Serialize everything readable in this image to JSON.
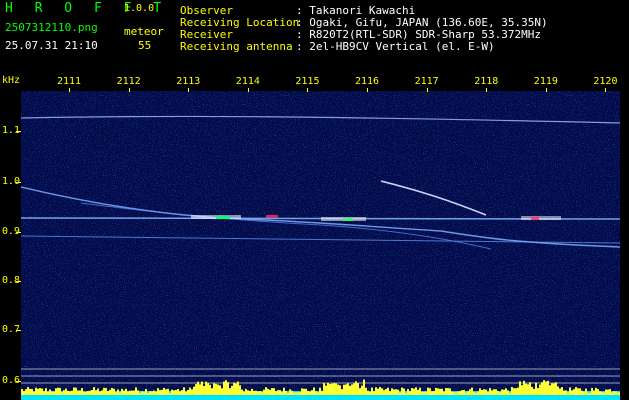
{
  "header": {
    "logo": "H R O F F T",
    "version": "1.0.0",
    "filename": "2507312110.png",
    "datetime": "25.07.31 21:10",
    "meteor_label": "meteor",
    "meteor_count": "55"
  },
  "info": {
    "observer_label": "Observer",
    "observer_value": ": Takanori Kawachi",
    "location_label": "Receiving Location",
    "location_value": ": Ogaki, Gifu, JAPAN (136.60E, 35.35N)",
    "receiver_label": "Receiver",
    "receiver_value": ": R820T2(RTL-SDR) SDR-Sharp 53.372MHz",
    "antenna_label": "Receiving antenna",
    "antenna_value": ": 2el-HB9CV Vertical (el. E-W)"
  },
  "axis": {
    "y_unit": "kHz",
    "time_ticks": [
      "2111",
      "2112",
      "2113",
      "2114",
      "2115",
      "2116",
      "2117",
      "2118",
      "2119",
      "2120"
    ],
    "freq_ticks": [
      "1.1",
      "1.0",
      "0.9",
      "0.8",
      "0.7",
      "0.6"
    ]
  },
  "colors": {
    "label": "#00ff00",
    "value": "#ffffff",
    "accent": "#ffff00",
    "background": "#020a4a",
    "signal": "#ffffff",
    "baseline": "#00e5ff"
  }
}
